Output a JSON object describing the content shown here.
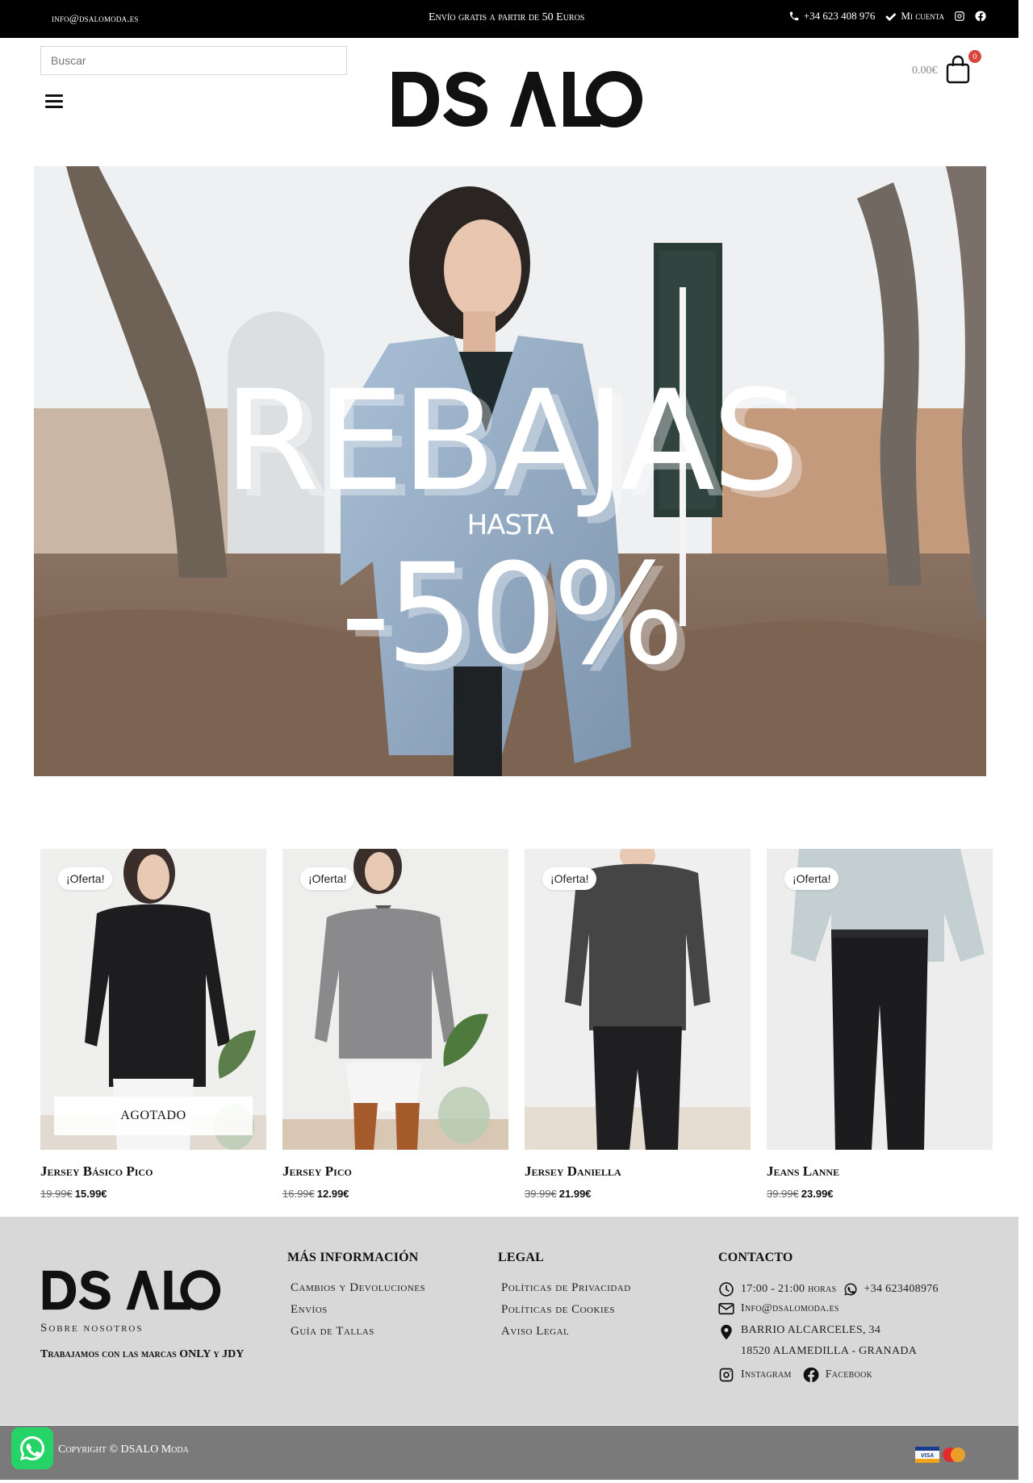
{
  "topbar": {
    "email": "info@dsalomoda.es",
    "shipping": "Envío gratis a partir de 50 Euros",
    "phone": "+34 623 408 976",
    "account": "Mi cuenta"
  },
  "header": {
    "search_placeholder": "Buscar",
    "logo": "DSALO",
    "cart_total": "0.00€",
    "cart_count": "0"
  },
  "hero": {
    "line1": "REBAJAS",
    "line2": "HASTA",
    "line3": "-50%"
  },
  "products": [
    {
      "badge": "¡Oferta!",
      "name": "Jersey Básico Pico",
      "old_price": "19.99€",
      "price": "15.99€",
      "soldout": "AGOTADO"
    },
    {
      "badge": "¡Oferta!",
      "name": "Jersey Pico",
      "old_price": "16.99€",
      "price": "12.99€"
    },
    {
      "badge": "¡Oferta!",
      "name": "Jersey Daniella",
      "old_price": "39.99€",
      "price": "21.99€"
    },
    {
      "badge": "¡Oferta!",
      "name": "Jeans Lanne",
      "old_price": "39.99€",
      "price": "23.99€"
    }
  ],
  "footer": {
    "logo": "DSALO",
    "about_title": "Sobre nosotros",
    "about_text": "Trabajamos con las marcas ONLY y JDY",
    "info": {
      "title": "MÁS INFORMACIÓN",
      "links": [
        "Cambios y Devoluciones",
        "Envíos",
        "Guía de Tallas"
      ]
    },
    "legal": {
      "title": "LEGAL",
      "links": [
        "Políticas de Privacidad",
        "Políticas de Cookies",
        "Aviso Legal"
      ]
    },
    "contact": {
      "title": "CONTACTO",
      "hours": "17:00 - 21:00 horas",
      "phone": "+34 623408976",
      "email": "Info@dsalomoda.es",
      "address1": "BARRIO ALCARCELES, 34",
      "address2": "18520 ALAMEDILLA - GRANADA",
      "instagram": "Instagram",
      "facebook": "Facebook"
    },
    "copyright": "Copyright © DSALO Moda"
  },
  "colors": {
    "topbar": "#000000",
    "footer": "#d8d8d8",
    "bottombar": "#7a7a7a",
    "badge": "#d9453b",
    "whatsapp": "#25d366"
  }
}
